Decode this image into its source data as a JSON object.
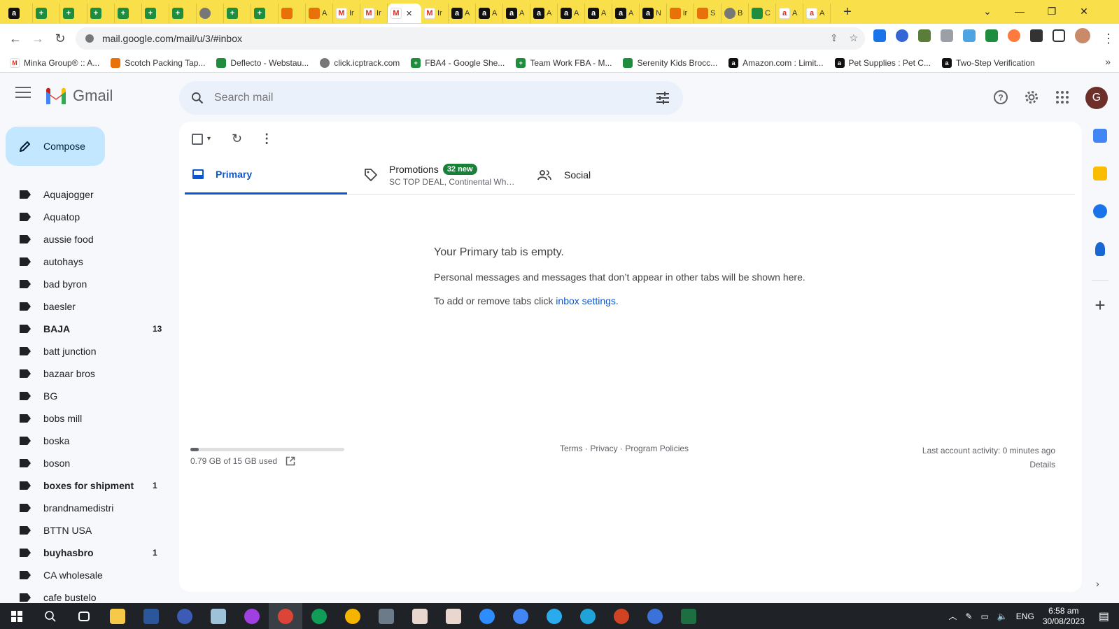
{
  "browser": {
    "tabs": [
      {
        "icon": "amazon-favicon",
        "label": ""
      },
      {
        "icon": "sheets-favicon",
        "label": ""
      },
      {
        "icon": "sheets-favicon",
        "label": ""
      },
      {
        "icon": "sheets-favicon",
        "label": ""
      },
      {
        "icon": "sheets-favicon",
        "label": ""
      },
      {
        "icon": "sheets-favicon",
        "label": ""
      },
      {
        "icon": "sheets-favicon",
        "label": ""
      },
      {
        "icon": "globe-favicon",
        "label": ""
      },
      {
        "icon": "sheets-favicon",
        "label": ""
      },
      {
        "icon": "sheets-favicon",
        "label": ""
      },
      {
        "icon": "pen-favicon",
        "label": ""
      },
      {
        "icon": "pen-favicon",
        "label": "A"
      },
      {
        "icon": "gmail-favicon",
        "label": "Ir"
      },
      {
        "icon": "gmail-favicon",
        "label": "Ir"
      },
      {
        "icon": "gmail-favicon",
        "label": "",
        "active": true
      },
      {
        "icon": "gmail-favicon",
        "label": "Ir"
      },
      {
        "icon": "amazon-favicon",
        "label": "A"
      },
      {
        "icon": "amazon-favicon",
        "label": "A"
      },
      {
        "icon": "amazon-favicon",
        "label": "A"
      },
      {
        "icon": "amazon-favicon",
        "label": "A"
      },
      {
        "icon": "amazon-favicon",
        "label": "A"
      },
      {
        "icon": "amazon-favicon",
        "label": "A"
      },
      {
        "icon": "amazon-favicon",
        "label": "A"
      },
      {
        "icon": "amazon-favicon",
        "label": "N"
      },
      {
        "icon": "shield-favicon",
        "label": "ir"
      },
      {
        "icon": "pin-favicon",
        "label": "S"
      },
      {
        "icon": "gb-favicon",
        "label": "B"
      },
      {
        "icon": "edge-favicon",
        "label": "C"
      },
      {
        "icon": "amazon-smile-favicon",
        "label": "A"
      },
      {
        "icon": "amazon-smile-favicon",
        "label": "A"
      }
    ],
    "url": "mail.google.com/mail/u/3/#inbox",
    "bookmarks": [
      {
        "icon": "m-favicon",
        "label": "Minka Group® :: A..."
      },
      {
        "icon": "oc-favicon",
        "label": "Scotch Packing Tap..."
      },
      {
        "icon": "leaf-favicon",
        "label": "Deflecto - Webstau..."
      },
      {
        "icon": "globe-favicon",
        "label": "click.icptrack.com"
      },
      {
        "icon": "sheets-favicon",
        "label": "FBA4 - Google She..."
      },
      {
        "icon": "sheets-favicon",
        "label": "Team Work FBA - M..."
      },
      {
        "icon": "plant-favicon",
        "label": "Serenity Kids Brocc..."
      },
      {
        "icon": "amazon-favicon",
        "label": "Amazon.com : Limit..."
      },
      {
        "icon": "amazon-favicon",
        "label": "Pet Supplies : Pet C..."
      },
      {
        "icon": "amazon-favicon",
        "label": "Two-Step Verification"
      }
    ]
  },
  "gmail": {
    "app_name": "Gmail",
    "search_placeholder": "Search mail",
    "avatar_letter": "G",
    "compose_label": "Compose",
    "labels": [
      {
        "name": "Aquajogger",
        "count": "",
        "bold": false
      },
      {
        "name": "Aquatop",
        "count": "",
        "bold": false
      },
      {
        "name": "aussie food",
        "count": "",
        "bold": false
      },
      {
        "name": "autohays",
        "count": "",
        "bold": false
      },
      {
        "name": "bad byron",
        "count": "",
        "bold": false
      },
      {
        "name": "baesler",
        "count": "",
        "bold": false
      },
      {
        "name": "BAJA",
        "count": "13",
        "bold": true
      },
      {
        "name": "batt junction",
        "count": "",
        "bold": false
      },
      {
        "name": "bazaar bros",
        "count": "",
        "bold": false
      },
      {
        "name": "BG",
        "count": "",
        "bold": false
      },
      {
        "name": "bobs mill",
        "count": "",
        "bold": false
      },
      {
        "name": "boska",
        "count": "",
        "bold": false
      },
      {
        "name": "boson",
        "count": "",
        "bold": false
      },
      {
        "name": "boxes for shipment",
        "count": "1",
        "bold": true
      },
      {
        "name": "brandnamedistri",
        "count": "",
        "bold": false
      },
      {
        "name": "BTTN USA",
        "count": "",
        "bold": false
      },
      {
        "name": "buyhasbro",
        "count": "1",
        "bold": true
      },
      {
        "name": "CA wholesale",
        "count": "",
        "bold": false
      },
      {
        "name": "cafe bustelo",
        "count": "",
        "bold": false
      }
    ],
    "tabs": {
      "primary": "Primary",
      "promotions": "Promotions",
      "promotions_badge": "32 new",
      "promotions_sub": "SC TOP DEAL, Continental Whol...",
      "social": "Social"
    },
    "empty": {
      "title": "Your Primary tab is empty.",
      "text": "Personal messages and messages that don’t appear in other tabs will be shown here.",
      "settings_prefix": "To add or remove tabs click ",
      "settings_link": "inbox settings",
      "settings_suffix": "."
    },
    "footer": {
      "storage": "0.79 GB of 15 GB used",
      "storage_fraction": 0.053,
      "terms": "Terms",
      "privacy": "Privacy",
      "policies": "Program Policies",
      "sep": " · ",
      "activity": "Last account activity: 0 minutes ago",
      "details": "Details"
    }
  },
  "taskbar": {
    "language": "ENG",
    "time": "6:58 am",
    "date": "30/08/2023"
  },
  "colors": {
    "tabstrip": "#f9e04b",
    "accent": "#0b57d0",
    "compose": "#c2e7ff",
    "badge": "#188038"
  }
}
